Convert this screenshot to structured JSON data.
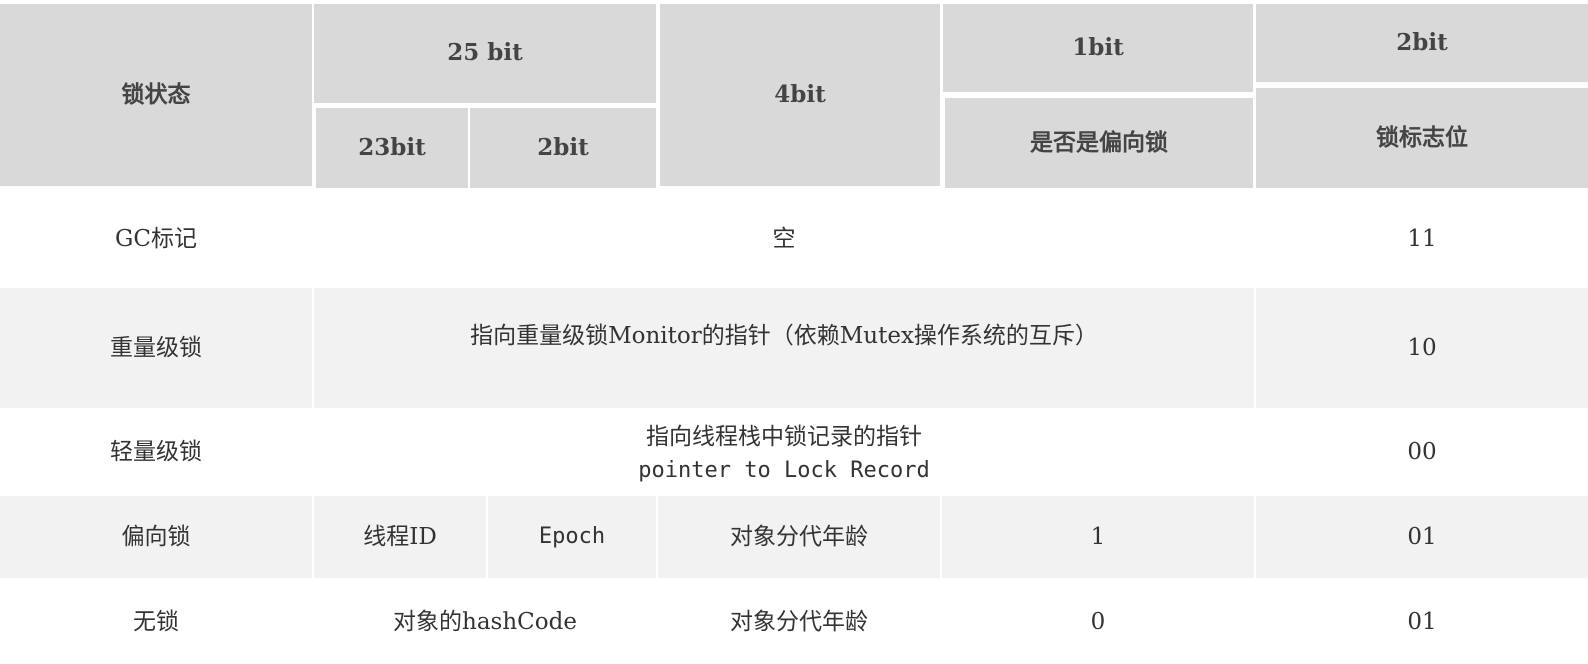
{
  "table": {
    "header": {
      "lock_state": "锁状态",
      "bits25": "25 bit",
      "bits23": "23bit",
      "bits2_sub": "2bit",
      "bits4": "4bit",
      "bit1": "1bit",
      "biased_flag": "是否是偏向锁",
      "bits2": "2bit",
      "lock_flag": "锁标志位"
    },
    "rows": [
      {
        "state": "GC标记",
        "content": "空",
        "flag": "11"
      },
      {
        "state": "重量级锁",
        "content": "指向重量级锁Monitor的指针（依赖Mutex操作系统的互斥）",
        "flag": "10"
      },
      {
        "state": "轻量级锁",
        "content_line1": "指向线程栈中锁记录的指针",
        "content_line2": "pointer to Lock Record",
        "flag": "00"
      },
      {
        "state": "偏向锁",
        "thread_id": "线程ID",
        "epoch": "Epoch",
        "age": "对象分代年龄",
        "biased": "1",
        "flag": "01"
      },
      {
        "state": "无锁",
        "hashcode": "对象的hashCode",
        "age": "对象分代年龄",
        "biased": "0",
        "flag": "01"
      }
    ]
  }
}
